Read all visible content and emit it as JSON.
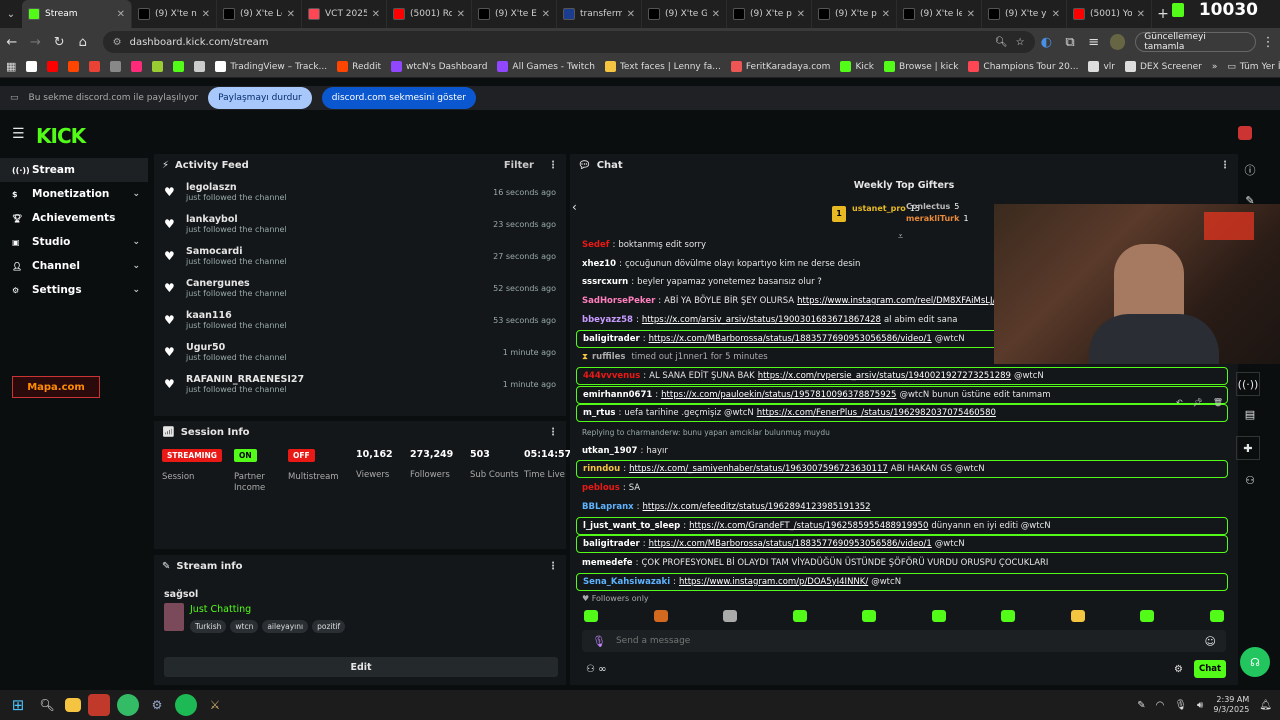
{
  "browser": {
    "tabs": [
      {
        "title": "Stream",
        "color": "#53fc18",
        "active": true
      },
      {
        "title": "(9) X'te no",
        "color": "#000000"
      },
      {
        "title": "(9) X'te Le",
        "color": "#000000"
      },
      {
        "title": "VCT 2025",
        "color": "#ff4655"
      },
      {
        "title": "(5001) Roc",
        "color": "#ff0000"
      },
      {
        "title": "(9) X'te Em",
        "color": "#000000"
      },
      {
        "title": "transferm",
        "color": "#1a3d8f"
      },
      {
        "title": "(9) X'te Gü",
        "color": "#000000"
      },
      {
        "title": "(9) X'te pu",
        "color": "#000000"
      },
      {
        "title": "(9) X'te pe",
        "color": "#000000"
      },
      {
        "title": "(9) X'te ley",
        "color": "#000000"
      },
      {
        "title": "(9) X'te yu",
        "color": "#000000"
      },
      {
        "title": "(5001) You",
        "color": "#ff0000"
      }
    ],
    "url": "dashboard.kick.com/stream",
    "update_label": "Güncellemeyi tamamla",
    "overlay_counter": "10030",
    "bookmarks": [
      {
        "label": "",
        "color": "#ffffff"
      },
      {
        "label": "",
        "color": "#ff0000"
      },
      {
        "label": "",
        "color": "#ff4500"
      },
      {
        "label": "",
        "color": "#ea4335"
      },
      {
        "label": "",
        "color": "#888888"
      },
      {
        "label": "",
        "color": "#ff2b7a"
      },
      {
        "label": "",
        "color": "#9acd32"
      },
      {
        "label": "",
        "color": "#53fc18"
      },
      {
        "label": "",
        "color": "#cccccc"
      },
      {
        "label": "TradingView – Track...",
        "color": "#ffffff"
      },
      {
        "label": "Reddit",
        "color": "#ff4500"
      },
      {
        "label": "wtcN's Dashboard",
        "color": "#9146ff"
      },
      {
        "label": "All Games - Twitch",
        "color": "#9146ff"
      },
      {
        "label": "Text faces | Lenny fa...",
        "color": "#f5c542"
      },
      {
        "label": "FeritKaradaya.com",
        "color": "#e55"
      },
      {
        "label": "Kick",
        "color": "#53fc18"
      },
      {
        "label": "Browse | kick",
        "color": "#53fc18"
      },
      {
        "label": "Champions Tour 20...",
        "color": "#ff4655"
      },
      {
        "label": "vlr",
        "color": "#dddddd"
      },
      {
        "label": "DEX Screener",
        "color": "#dddddd"
      }
    ],
    "all_bookmarks": "Tüm Yer İşaretleri"
  },
  "share_bar": {
    "text": "Bu sekme discord.com ile paylaşılıyor",
    "stop_label": "Paylaşmayı durdur",
    "show_label": "discord.com sekmesini göster"
  },
  "sidebar": {
    "items": [
      {
        "label": "Stream",
        "icon": "radio-icon",
        "active": true,
        "chevron": false
      },
      {
        "label": "Monetization",
        "icon": "dollar-icon",
        "chevron": true
      },
      {
        "label": "Achievements",
        "icon": "trophy-icon",
        "chevron": false
      },
      {
        "label": "Studio",
        "icon": "studio-icon",
        "chevron": true
      },
      {
        "label": "Channel",
        "icon": "channel-icon",
        "chevron": true
      },
      {
        "label": "Settings",
        "icon": "gear-icon",
        "chevron": true
      }
    ],
    "promo_text": "Mapa.com"
  },
  "activity_feed": {
    "title": "Activity Feed",
    "filter_label": "Filter",
    "items": [
      {
        "user": "legolaszn",
        "action": "just followed the channel",
        "time": "16 seconds ago"
      },
      {
        "user": "lankaybol",
        "action": "just followed the channel",
        "time": "23 seconds ago"
      },
      {
        "user": "Samocardi",
        "action": "just followed the channel",
        "time": "27 seconds ago"
      },
      {
        "user": "Canergunes",
        "action": "just followed the channel",
        "time": "52 seconds ago"
      },
      {
        "user": "kaan116",
        "action": "just followed the channel",
        "time": "53 seconds ago"
      },
      {
        "user": "Ugur50",
        "action": "just followed the channel",
        "time": "1 minute ago"
      },
      {
        "user": "RAFANIN_RRAENESI27",
        "action": "just followed the channel",
        "time": "1 minute ago"
      }
    ]
  },
  "session_info": {
    "title": "Session Info",
    "stats": [
      {
        "badge": "STREAMING",
        "badge_color": "#e91916",
        "label": "Session"
      },
      {
        "badge": "ON",
        "badge_color": "#53fc18",
        "label": "Partner Income"
      },
      {
        "badge": "OFF",
        "badge_color": "#e91916",
        "label": "Multistream"
      },
      {
        "value": "10,162",
        "label": "Viewers"
      },
      {
        "value": "273,249",
        "label": "Followers"
      },
      {
        "value": "503",
        "label": "Sub Counts"
      },
      {
        "value": "05:14:57",
        "label": "Time Live"
      }
    ]
  },
  "stream_info": {
    "title": "Stream info",
    "stream_title": "sağsol",
    "category": "Just Chatting",
    "tags": [
      "Turkish",
      "wtcn",
      "aileyayını",
      "pozitif"
    ],
    "edit_label": "Edit"
  },
  "chat": {
    "title": "Chat",
    "weekly_gifters_title": "Weekly Top Gifters",
    "gifters": [
      {
        "name": "ustanet_pro",
        "count": "15",
        "color": "#e8b923"
      },
      {
        "name": "Conlectus",
        "count": "5",
        "color": "#bbbbbb"
      },
      {
        "name": "merakliTurk",
        "count": "1",
        "color": "#e88a3a"
      }
    ],
    "rank_badge": "1",
    "messages": [
      {
        "user": "Sedef",
        "color": "#e91916",
        "text": "boktanmış edit sorry",
        "link": "",
        "after": "",
        "hl": false
      },
      {
        "user": "xhez10",
        "color": "#ffffff",
        "text": "çocuğunun dövülme olayı kopartıyo kim ne derse desin",
        "link": "",
        "after": "",
        "hl": false
      },
      {
        "user": "sssrcxurn",
        "color": "#ffffff",
        "text": "beyler yapamaz yonetemez basarısız olur ?",
        "link": "",
        "after": "",
        "hl": false
      },
      {
        "user": "SadHorsePeker",
        "color": "#ff7fbf",
        "text": "ABİ YA BÖYLE BİR ŞEY OLURSA",
        "link": "https://www.instagram.com/reel/DM8XFAiMsLJ/?igsh=azg2az",
        "after": "",
        "hl": false
      },
      {
        "user": "bbeyazz58",
        "color": "#c79bff",
        "text": "",
        "link": "https://x.com/arsiv_arsiv/status/1900301683671867428",
        "after": "al abim edit sana",
        "hl": false
      },
      {
        "user": "baligitrader",
        "color": "#ffffff",
        "text": "",
        "link": "https://x.com/MBarborossa/status/1883577690953056586/video/1",
        "after": "@wtcN",
        "hl": true
      },
      {
        "user": "ruffiles",
        "color": "#aaaaaa",
        "text": "timed out j1nner1 for 5 minutes",
        "link": "",
        "after": "",
        "hl": false,
        "system": true
      },
      {
        "user": "444vvvenus",
        "color": "#e91916",
        "text": "AL SANA EDİT ŞUNA BAK",
        "link": "https://x.com/rvpersie_arsiv/status/1940021927273251289",
        "after": "@wtcN",
        "hl": true
      },
      {
        "user": "emirhann0671",
        "color": "#ffffff",
        "text": "",
        "link": "https://x.com/pauloekin/status/1957810096378875925",
        "after": "@wtcN bunun üstüne edit tanımam",
        "hl": true
      },
      {
        "user": "m_rtus",
        "color": "#ffffff",
        "text": "uefa tarihine .geçmişiz @wtcN",
        "link": "https://x.com/FenerPlus_/status/1962982037075460580",
        "after": "",
        "hl": true
      },
      {
        "user": "",
        "color": "#aaaaaa",
        "text": "Replying to charmanderw: bunu yapan amcıklar bulunmuş muydu",
        "link": "",
        "after": "",
        "hl": false,
        "reply": true
      },
      {
        "user": "utkan_1907",
        "color": "#ffffff",
        "text": "hayır",
        "link": "",
        "after": "",
        "hl": false
      },
      {
        "user": "rinndou",
        "color": "#f5c542",
        "text": "",
        "link": "https://x.com/_samiyenhaber/status/1963007596723630117",
        "after": "ABI HAKAN GS @wtcN",
        "hl": true
      },
      {
        "user": "peblous",
        "color": "#e91916",
        "text": "SA",
        "link": "",
        "after": "",
        "hl": false
      },
      {
        "user": "BBLapranx",
        "color": "#5fb3ff",
        "text": "",
        "link": "https://x.com/efeeditz/status/1962894123985191352",
        "after": "",
        "hl": false
      },
      {
        "user": "l_just_want_to_sleep",
        "color": "#ffffff",
        "text": "",
        "link": "https://x.com/GrandeFT_/status/1962585955488919950",
        "after": "dünyanın en iyi editi @wtcN",
        "hl": true
      },
      {
        "user": "baligitrader",
        "color": "#ffffff",
        "text": "",
        "link": "https://x.com/MBarborossa/status/1883577690953056586/video/1",
        "after": "@wtcN",
        "hl": true
      },
      {
        "user": "memedefe",
        "color": "#ffffff",
        "text": "ÇOK PROFESYONEL Bİ OLAYDI TAM VİYADÜĞÜN ÜSTÜNDE ŞÖFÖRÜ VURDU ORUSPU ÇOCUKLARI",
        "link": "",
        "after": "",
        "hl": false
      },
      {
        "user": "Sena_Kahsiwazaki",
        "color": "#5fb3ff",
        "text": "",
        "link": "https://www.instagram.com/p/DOA5yI4INNK/",
        "after": "@wtcN",
        "hl": true
      }
    ],
    "followers_only": "Followers only",
    "input_placeholder": "Send a message",
    "send_label": "Chat"
  },
  "taskbar": {
    "time": "2:39 AM",
    "date": "9/3/2025"
  }
}
